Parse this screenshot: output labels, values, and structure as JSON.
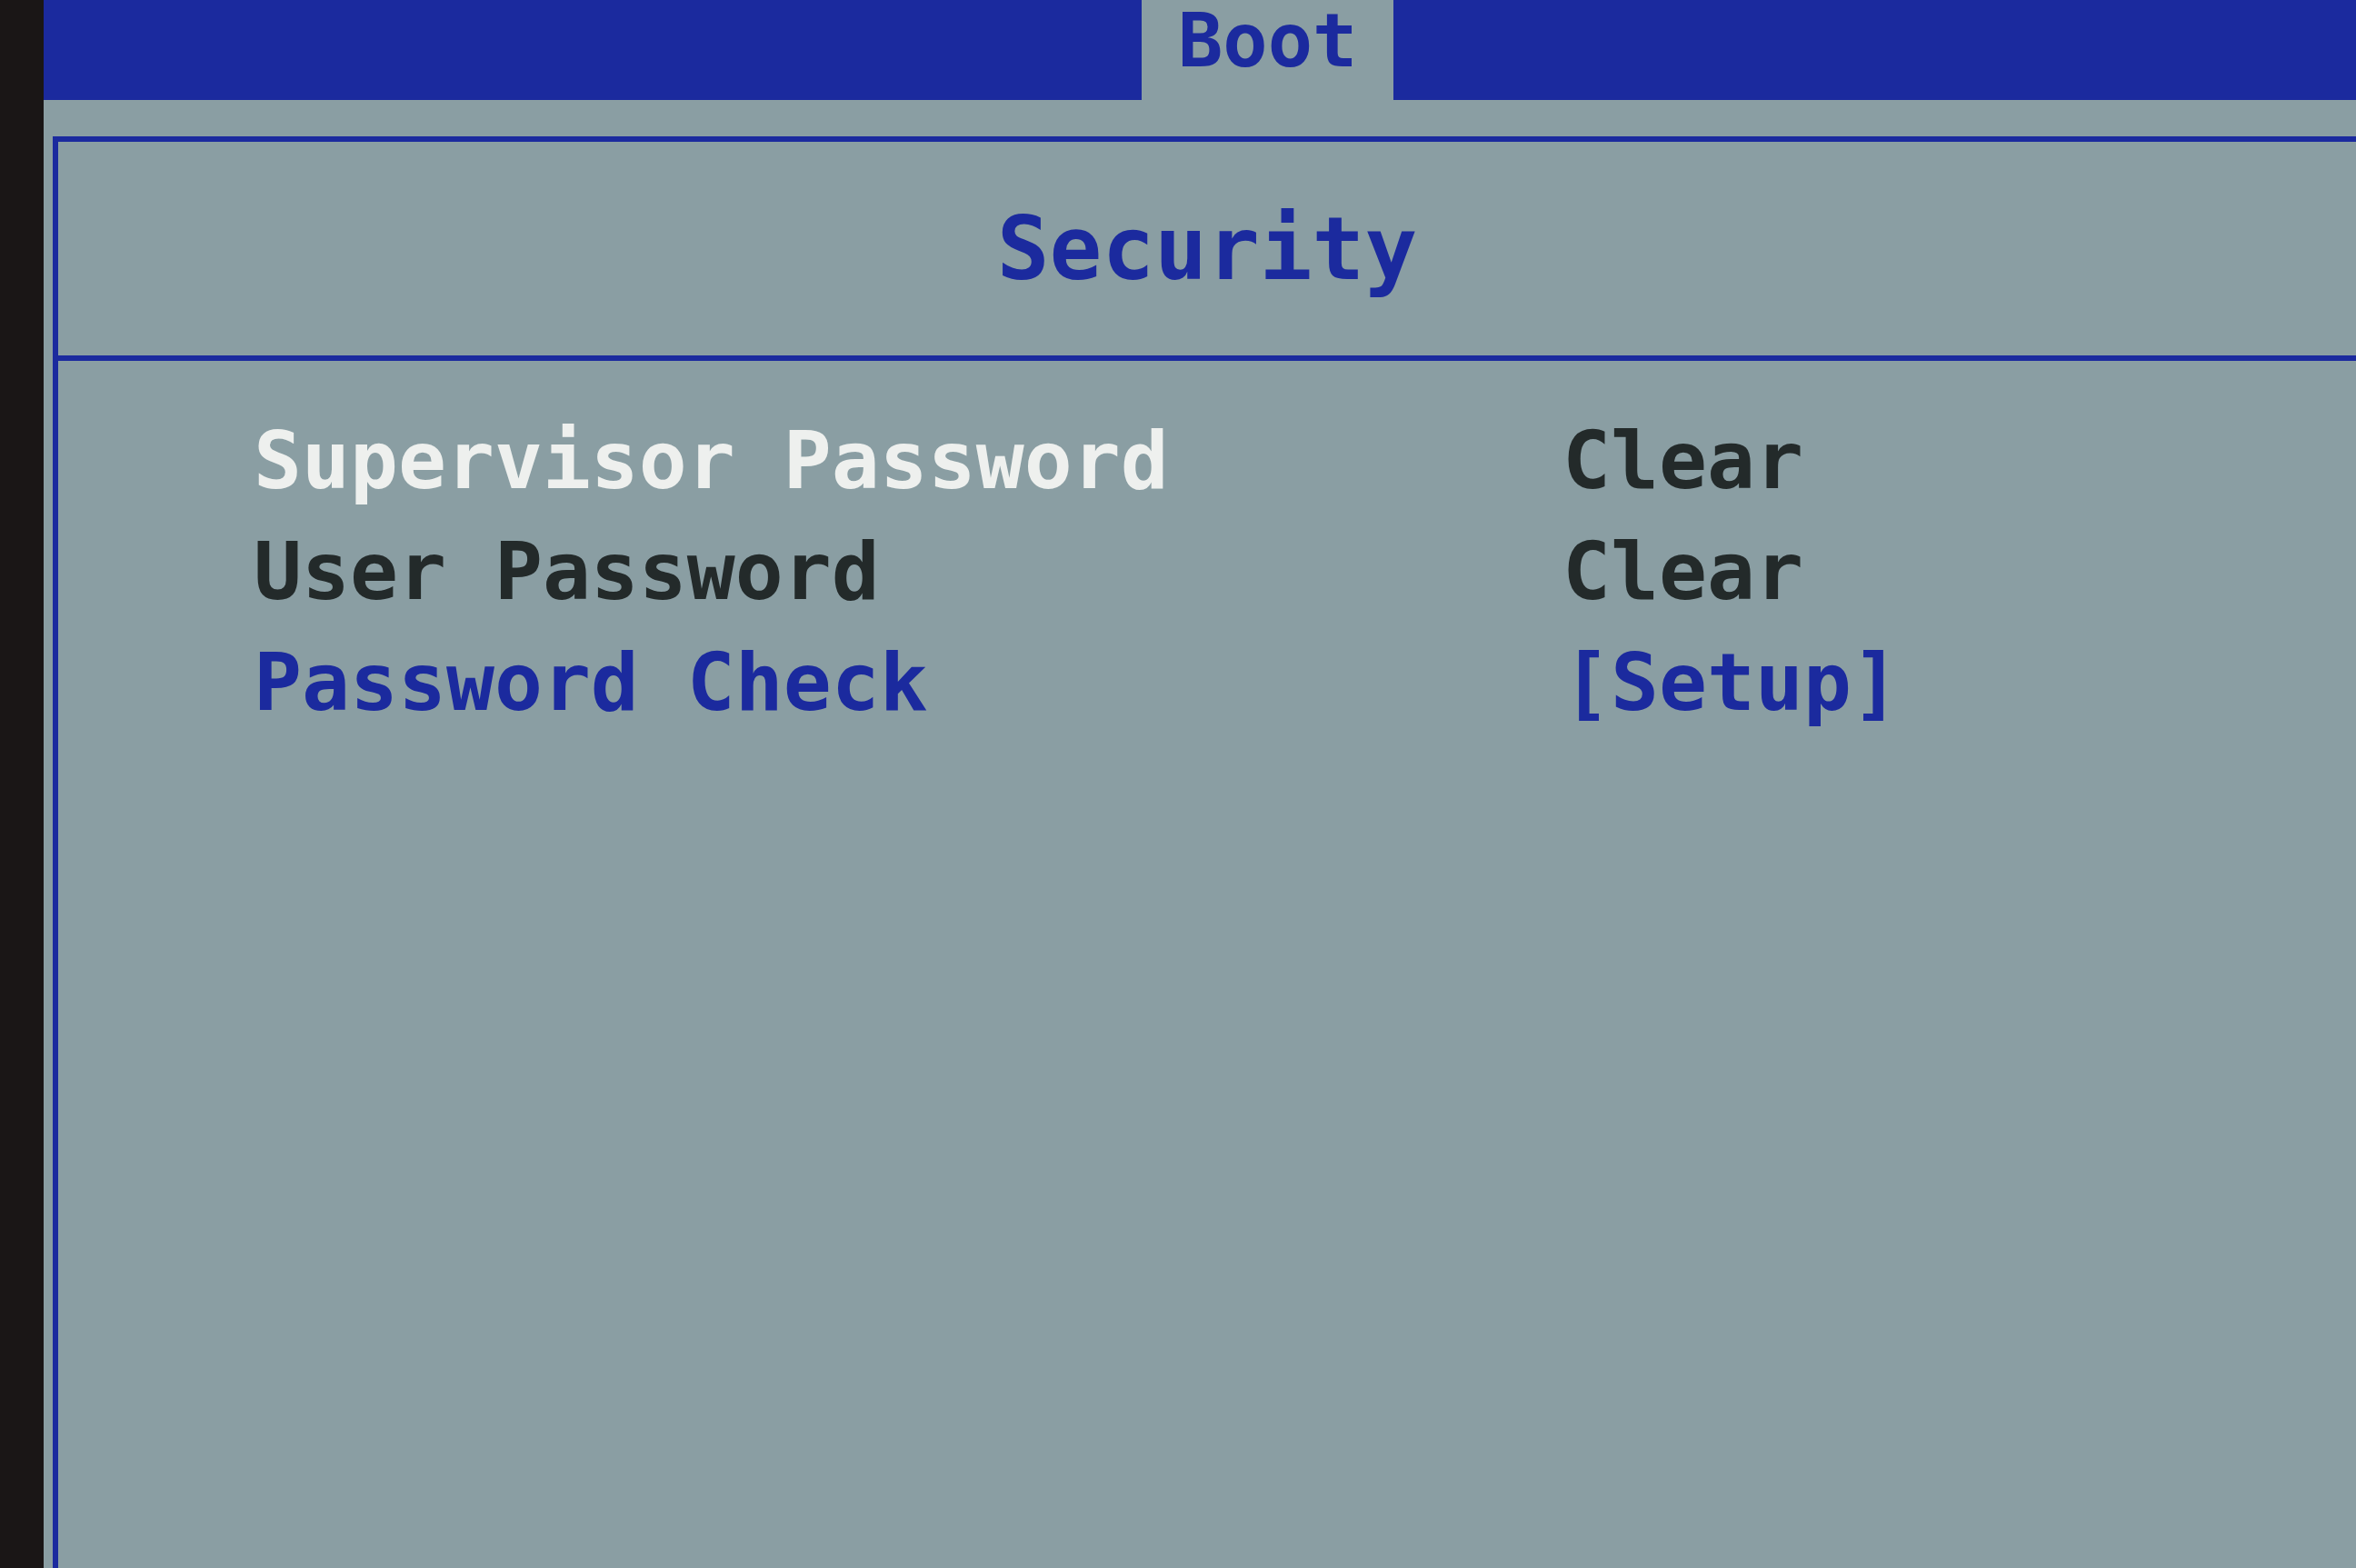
{
  "menu_bar": {
    "tabs": [
      {
        "label": "Boot",
        "selected": true
      }
    ]
  },
  "panel": {
    "title": "Security",
    "items": [
      {
        "label": "Supervisor Password",
        "value": "Clear",
        "kind": "status",
        "selected": true
      },
      {
        "label": "User Password",
        "value": "Clear",
        "kind": "status",
        "selected": false
      },
      {
        "label": "Password Check",
        "value": "[Setup]",
        "kind": "option",
        "selected": false
      }
    ]
  }
}
